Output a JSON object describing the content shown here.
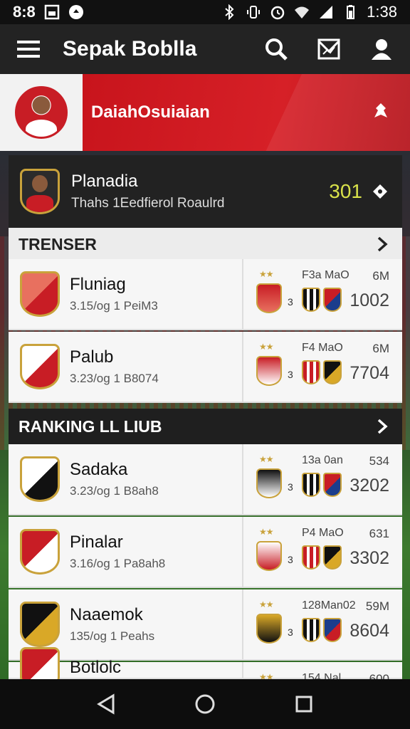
{
  "status_bar": {
    "left_text": "8:8",
    "time": "1:38",
    "icons": [
      "image-icon",
      "notification-icon",
      "bluetooth-icon",
      "vibrate-icon",
      "alarm-icon",
      "wifi-icon",
      "signal-icon",
      "battery-icon"
    ]
  },
  "app_bar": {
    "title": "Sepak Boblla",
    "icons": [
      "menu-icon",
      "search-icon",
      "inbox-icon",
      "profile-icon"
    ]
  },
  "hero": {
    "title": "DaiahOsuiaian",
    "icon": "pin-icon"
  },
  "featured": {
    "name": "Planadia",
    "subtitle": "Thahs 1Eedfierol Roaulrd",
    "score": "301",
    "icon": "diamond-icon"
  },
  "sections": [
    {
      "title": "TRENSER",
      "rows": [
        {
          "name": "Fluniag",
          "sub": "3.15/og 1 PeiM3",
          "label": "F3a MaO",
          "count": "6M",
          "value": "1002",
          "num": "3"
        },
        {
          "name": "Palub",
          "sub": "3.23/og 1 B8074",
          "label": "F4 MaO",
          "count": "6M",
          "value": "7704",
          "num": "3"
        }
      ]
    },
    {
      "title": "RANKING LL LIUB",
      "rows": [
        {
          "name": "Sadaka",
          "sub": "3.23/og 1 B8ah8",
          "label": "13a 0an",
          "count": "534",
          "value": "3202",
          "num": "3"
        },
        {
          "name": "Pinalar",
          "sub": "3.16/og 1 Pa8ah8",
          "label": "P4 MaO",
          "count": "631",
          "value": "3302",
          "num": "3"
        },
        {
          "name": "Naaemok",
          "sub": "135/og 1 Peahs",
          "label": "128Man02",
          "count": "59M",
          "value": "8604",
          "num": "3"
        },
        {
          "name": "Botlolc",
          "sub": "",
          "label": "154 Nal",
          "count": "600",
          "value": "",
          "num": ""
        }
      ]
    }
  ],
  "colors": {
    "accent_red": "#c8141c",
    "score_yellow": "#d9e24a",
    "gold": "#c9a23b",
    "dark": "#222222"
  },
  "nav_bar": {
    "icons": [
      "back-icon",
      "home-icon",
      "recents-icon"
    ]
  }
}
